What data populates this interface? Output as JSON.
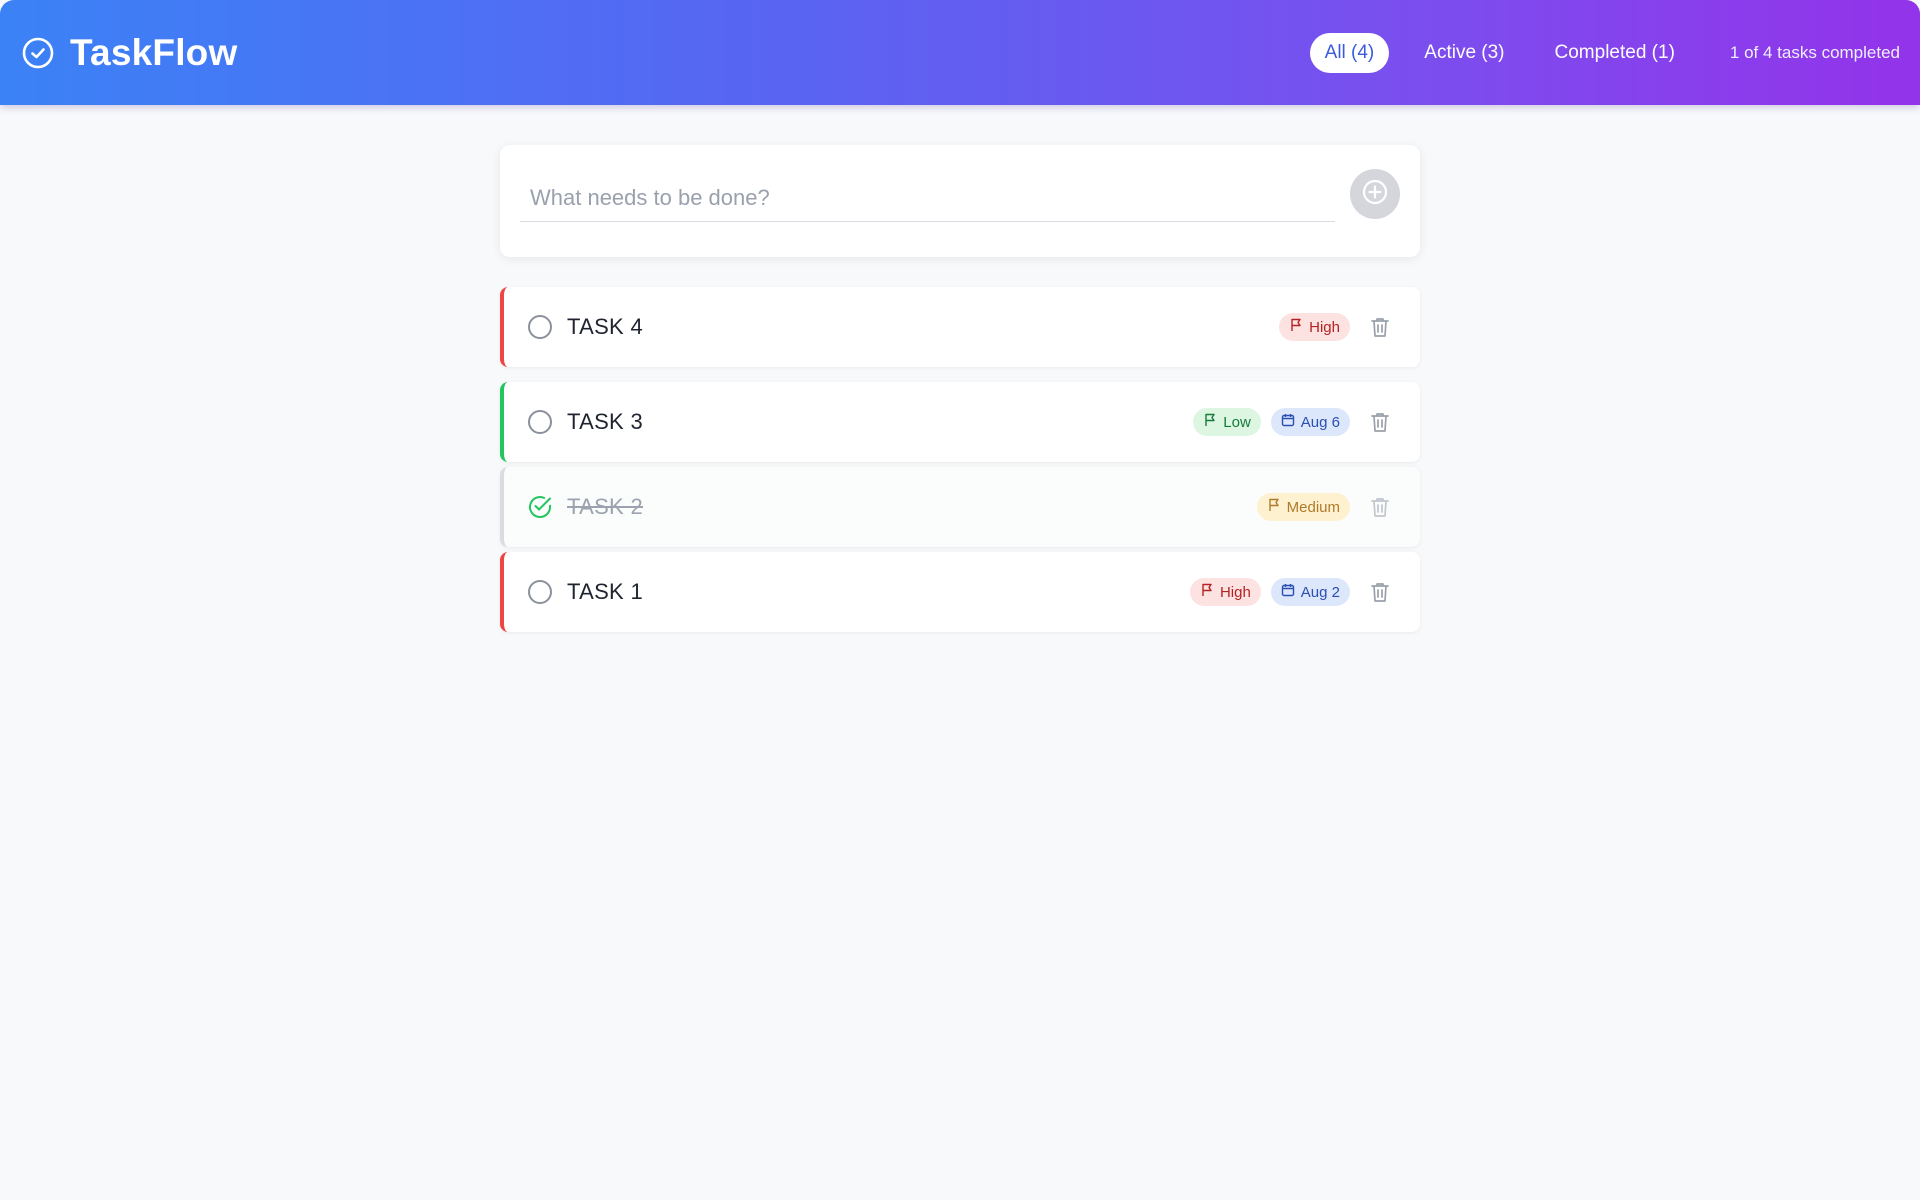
{
  "app": {
    "title": "TaskFlow",
    "accent": "#3b82f6",
    "accent_end": "#9333ea"
  },
  "header": {
    "filters": [
      {
        "label": "All (4)",
        "active": true
      },
      {
        "label": "Active (3)",
        "active": false
      },
      {
        "label": "Completed (1)",
        "active": false
      }
    ],
    "summary": "1 of 4 tasks completed"
  },
  "new_task": {
    "placeholder": "What needs to be done?",
    "value": ""
  },
  "tasks": [
    {
      "title": "TASK 4",
      "completed": false,
      "priority": "High",
      "due": ""
    },
    {
      "title": "TASK 3",
      "completed": false,
      "priority": "Low",
      "due": "Aug 6"
    },
    {
      "title": "TASK 2",
      "completed": true,
      "priority": "Medium",
      "due": ""
    },
    {
      "title": "TASK 1",
      "completed": false,
      "priority": "High",
      "due": "Aug 2"
    }
  ],
  "colors": {
    "high": "#ef4444",
    "low": "#22c55e",
    "medium": "#d9dce1",
    "done_check": "#22c55e"
  },
  "icons": {
    "brand": "check-circle-icon",
    "add": "plus-circle-icon",
    "priority": "flag-icon",
    "due": "calendar-icon",
    "delete": "trash-icon",
    "incomplete": "circle-icon",
    "complete": "check-circle-icon"
  }
}
